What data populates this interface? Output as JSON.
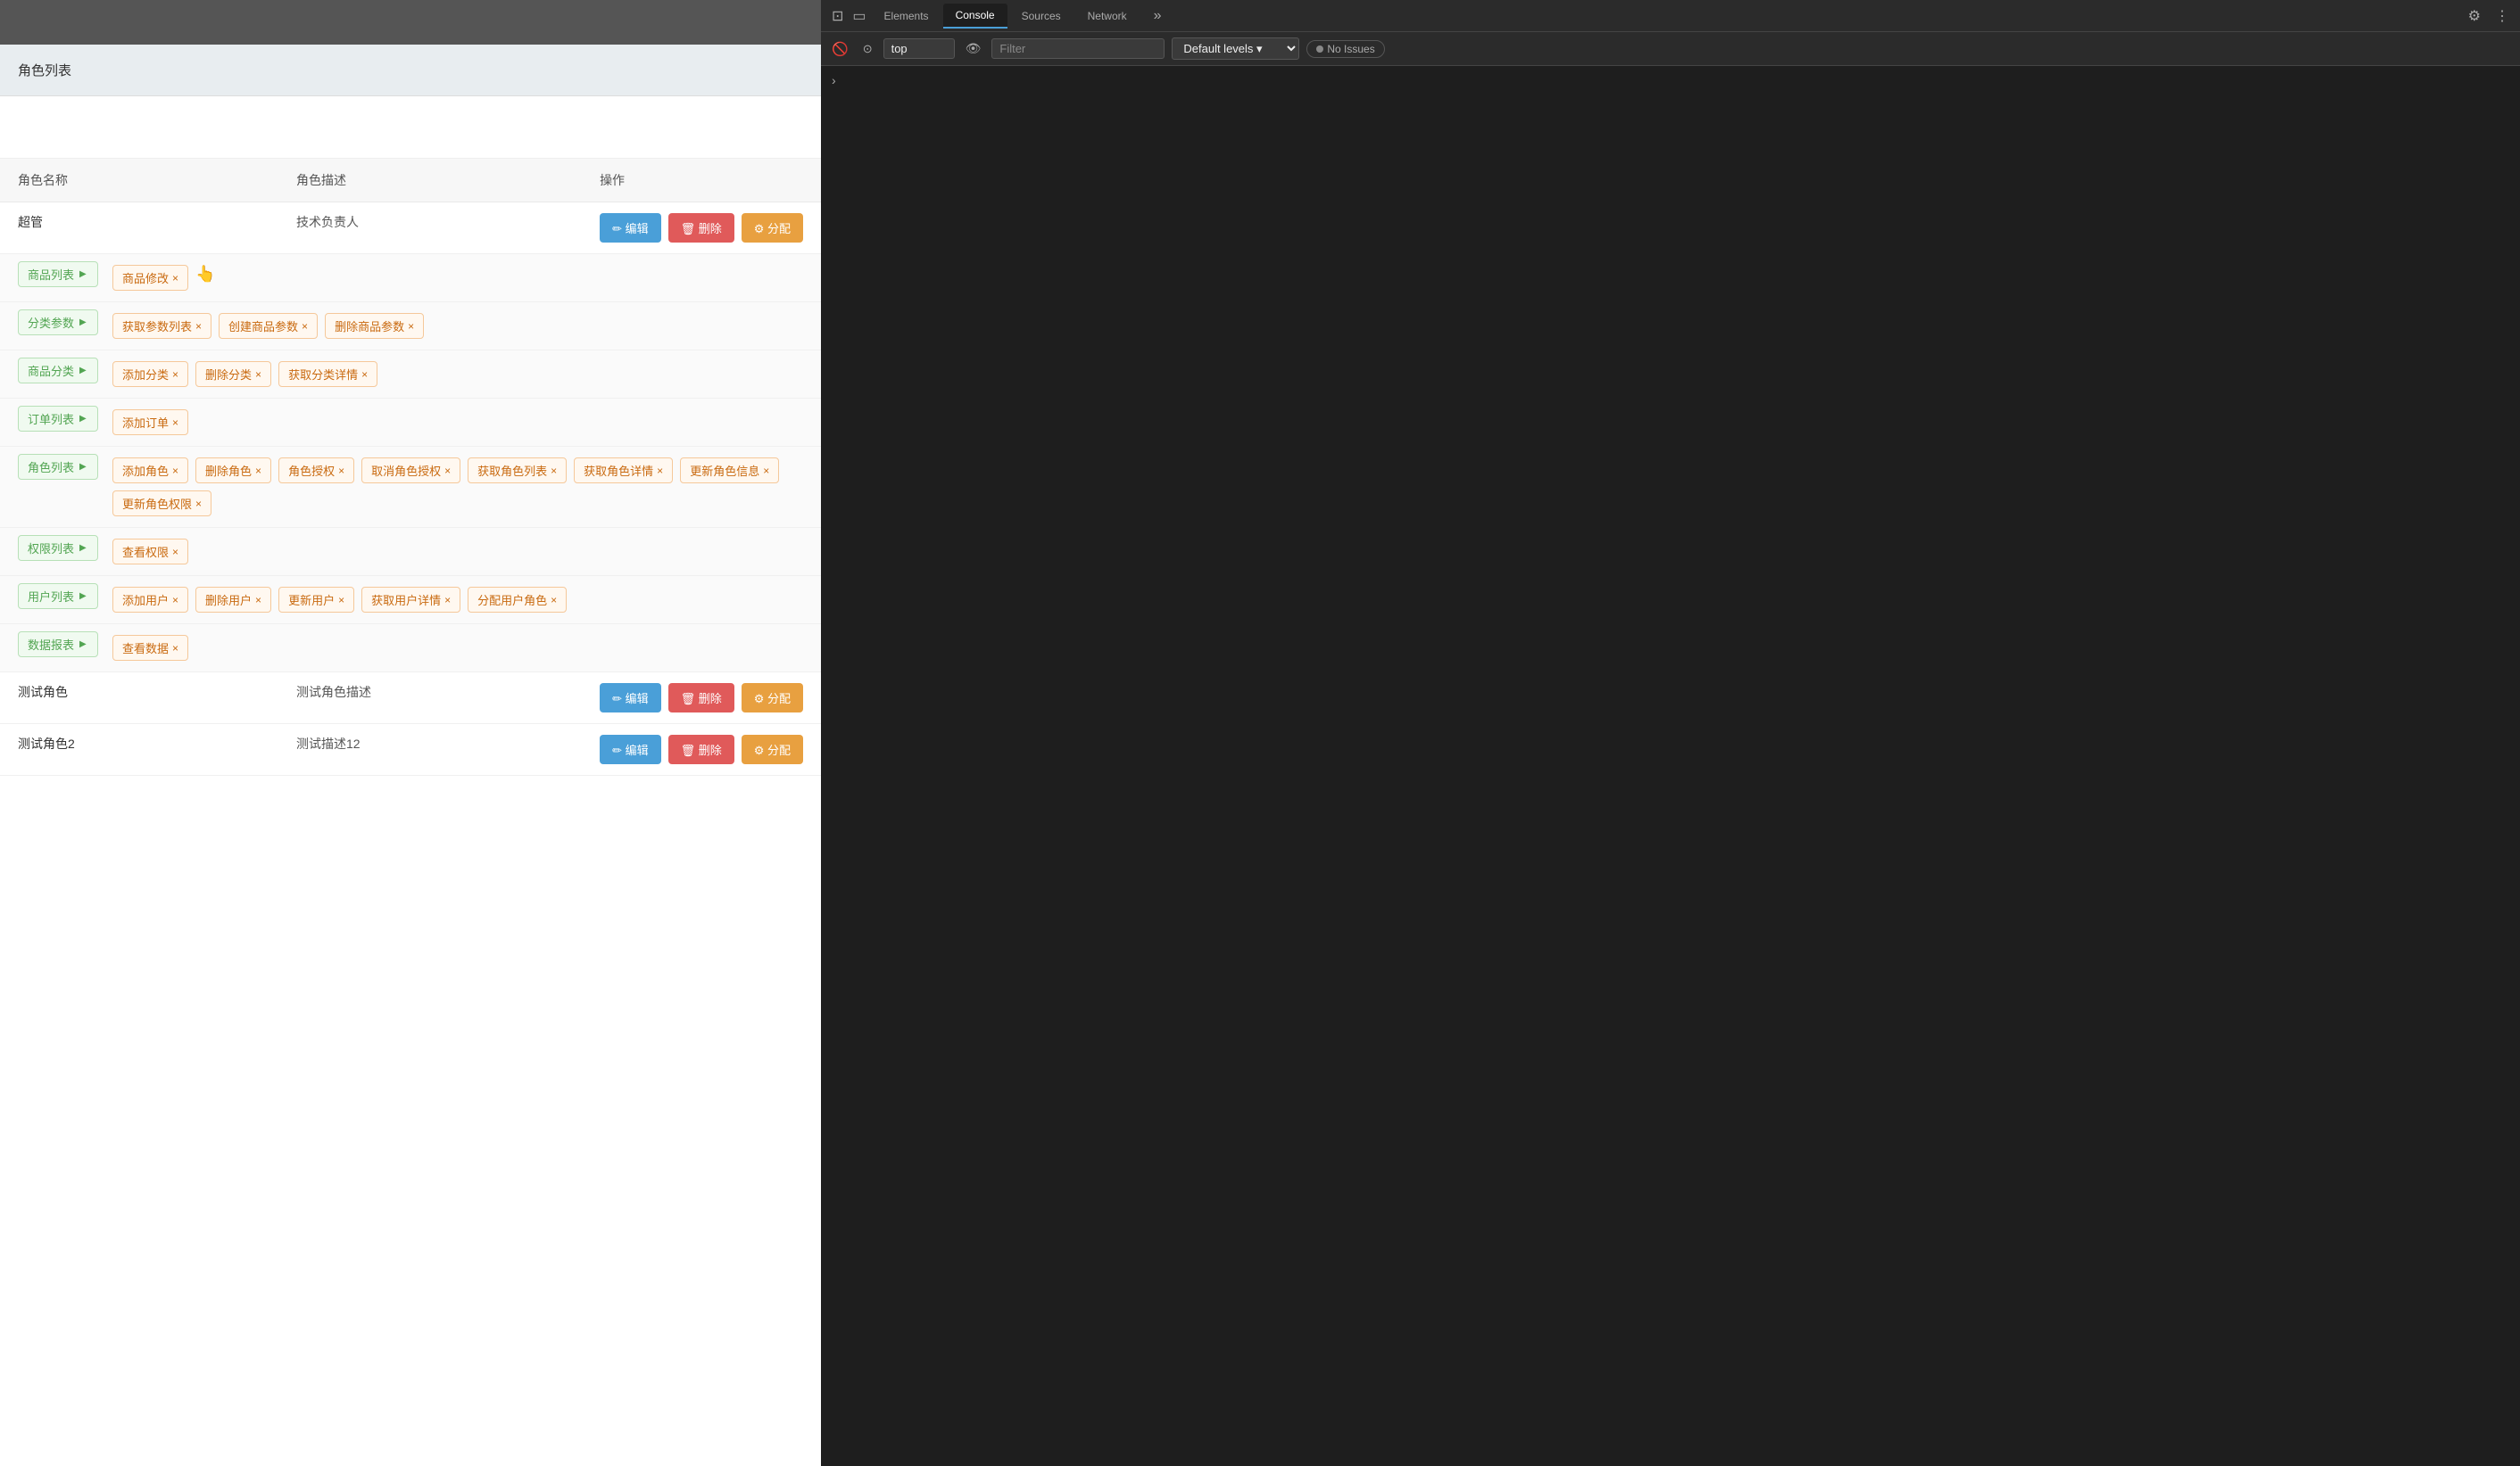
{
  "breadcrumb": "角色列表",
  "table": {
    "headers": {
      "name": "角色名称",
      "desc": "角色描述",
      "action": "操作"
    },
    "rows": [
      {
        "id": "admin",
        "name": "超管",
        "desc": "技术负责人",
        "expanded": true,
        "permissions": [
          {
            "menu": "商品列表",
            "perms": [
              "商品修改"
            ]
          },
          {
            "menu": "分类参数",
            "perms": [
              "获取参数列表",
              "创建商品参数",
              "删除商品参数"
            ]
          },
          {
            "menu": "商品分类",
            "perms": [
              "添加分类",
              "删除分类",
              "获取分类详情"
            ]
          },
          {
            "menu": "订单列表",
            "perms": [
              "添加订单"
            ]
          },
          {
            "menu": "角色列表",
            "perms": [
              "添加角色",
              "删除角色",
              "角色授权",
              "取消角色授权",
              "获取角色列表",
              "获取角色详情",
              "更新角色信息",
              "更新角色权限"
            ]
          },
          {
            "menu": "权限列表",
            "perms": [
              "查看权限"
            ]
          },
          {
            "menu": "用户列表",
            "perms": [
              "添加用户",
              "删除用户",
              "更新用户",
              "获取用户详情",
              "分配用户角色"
            ]
          },
          {
            "menu": "数据报表",
            "perms": [
              "查看数据"
            ]
          }
        ],
        "buttons": {
          "edit": "编辑",
          "delete": "删除",
          "assign": "分配"
        }
      },
      {
        "id": "test1",
        "name": "测试角色",
        "desc": "测试角色描述",
        "expanded": false,
        "permissions": [],
        "buttons": {
          "edit": "编辑",
          "delete": "删除",
          "assign": "分配"
        }
      },
      {
        "id": "test2",
        "name": "测试角色2",
        "desc": "测试描述12",
        "expanded": false,
        "permissions": [],
        "buttons": {
          "edit": "编辑",
          "delete": "删除",
          "assign": "分配"
        }
      }
    ]
  },
  "devtools": {
    "tabs": [
      "Elements",
      "Console",
      "Sources",
      "Network",
      "More"
    ],
    "active_tab": "Console",
    "top_value": "top",
    "filter_placeholder": "Filter",
    "levels_label": "Default levels",
    "no_issues_label": "No Issues",
    "icons": {
      "inspect": "⊡",
      "device": "▭",
      "close": "×",
      "settings": "⚙",
      "more": "⋮",
      "eye": "👁",
      "arrow": "›",
      "block": "🚫",
      "gear": "⚙"
    }
  },
  "buttons": {
    "edit_icon": "✏",
    "delete_icon": "🗑",
    "assign_icon": "⚙"
  }
}
